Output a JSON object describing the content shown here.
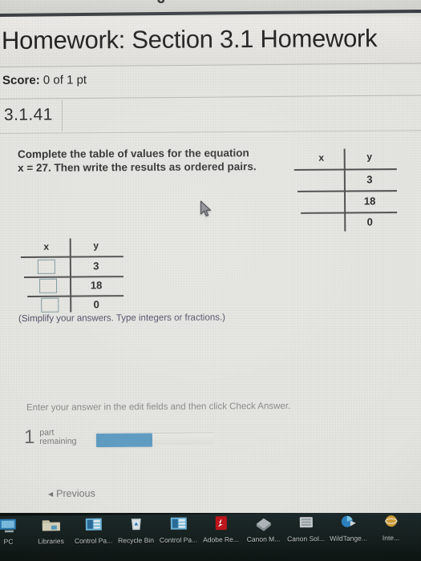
{
  "top_sliver": {
    "partial_glyph": "J"
  },
  "header": {
    "title": "Homework: Section 3.1 Homework",
    "score_label": "Score:",
    "score_value": "0 of 1 pt",
    "question_id": "3.1.41"
  },
  "question": {
    "line1": "Complete the table of values for the equation",
    "line2_equation": "x = 27",
    "line2_rest": ". Then write the results as ordered pairs.",
    "hint": "(Simplify your answers. Type integers or fractions.)"
  },
  "given_table": {
    "headers": [
      "x",
      "y"
    ],
    "rows": [
      {
        "x": "",
        "y": "3"
      },
      {
        "x": "",
        "y": "18"
      },
      {
        "x": "",
        "y": "0"
      }
    ]
  },
  "answer_table": {
    "headers": [
      "x",
      "y"
    ],
    "rows": [
      {
        "x_input_value": "",
        "x_input_placeholder": "",
        "y": "3"
      },
      {
        "x_input_value": "",
        "x_input_placeholder": "",
        "y": "18"
      },
      {
        "x_input_value": "",
        "x_input_placeholder": "",
        "y": "0"
      }
    ]
  },
  "footer": {
    "enter_note": "Enter your answer in the edit fields and then click Check Answer.",
    "parts_count": "1",
    "parts_label_line1": "part",
    "parts_label_line2": "remaining",
    "check_answer_label": "",
    "previous_label": "Previous"
  },
  "colors": {
    "page_background": "#e9e9e5",
    "header_rule": "#3e4247",
    "check_button": "#5e9ec6",
    "input_border": "#7d9aa3",
    "hint_text": "#4c4c66",
    "taskbar": "#16211f"
  },
  "taskbar": {
    "items": [
      {
        "label": "PC",
        "icon": "this-pc-icon"
      },
      {
        "label": "Libraries",
        "icon": "folder-icon"
      },
      {
        "label": "Control Pa...",
        "icon": "control-panel-icon"
      },
      {
        "label": "Recycle Bin",
        "icon": "recycle-bin-icon"
      },
      {
        "label": "Control Pa...",
        "icon": "control-panel-icon"
      },
      {
        "label": "Adobe Re...",
        "icon": "adobe-reader-icon"
      },
      {
        "label": "Canon M...",
        "icon": "canon-mp-icon"
      },
      {
        "label": "Canon Sol...",
        "icon": "canon-solution-icon"
      },
      {
        "label": "WildTange...",
        "icon": "wildtangent-icon"
      },
      {
        "label": "Inte...",
        "icon": "internet-explorer-icon"
      }
    ]
  }
}
